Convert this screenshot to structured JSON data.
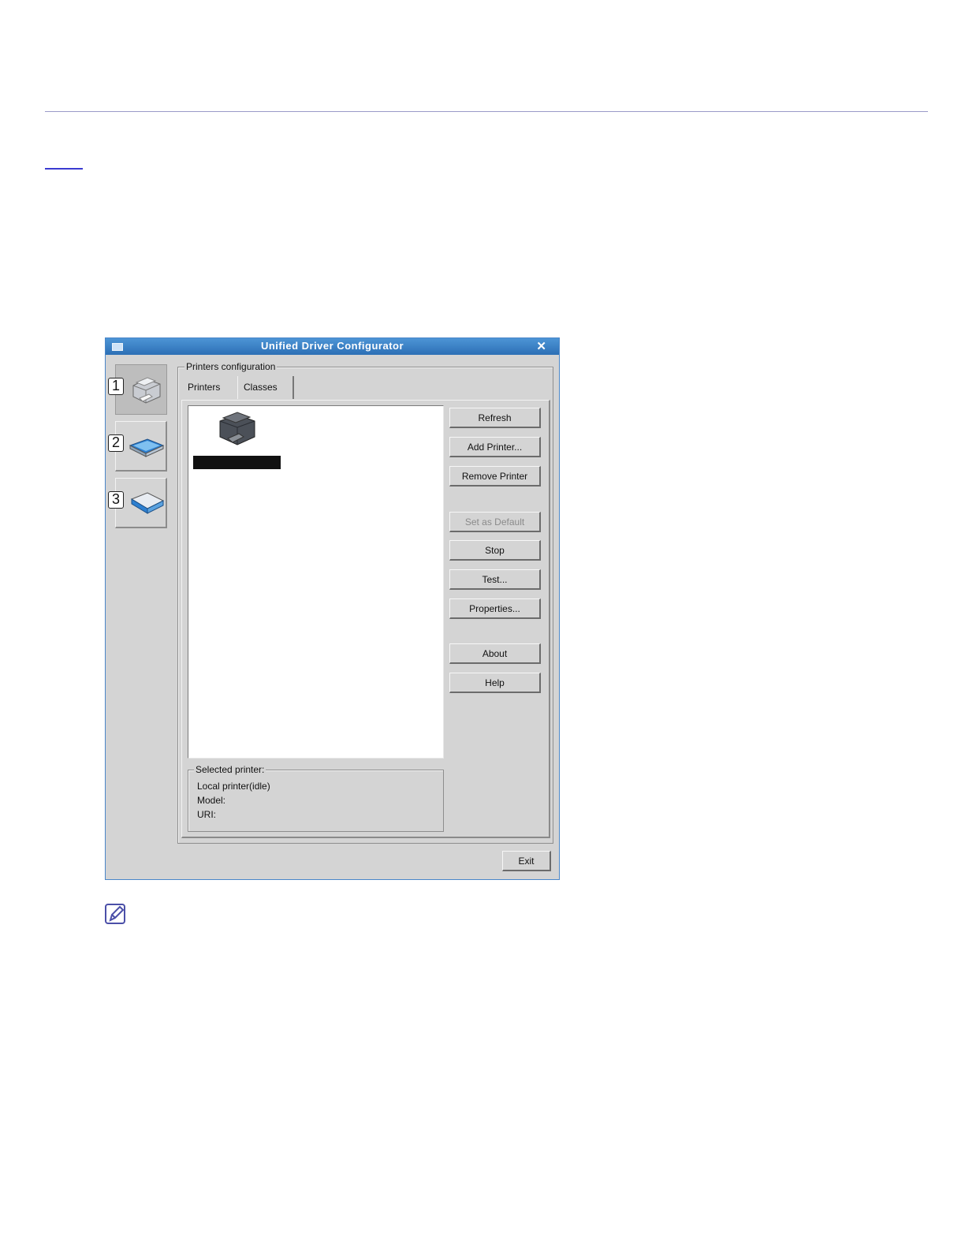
{
  "window": {
    "title": "Unified Driver Configurator",
    "close_glyph": "✕",
    "accent_color": "#2c6fb5"
  },
  "sidebar": {
    "items": [
      {
        "badge": "1",
        "icon": "printer-icon",
        "active": true
      },
      {
        "badge": "2",
        "icon": "scanner-icon",
        "active": false
      },
      {
        "badge": "3",
        "icon": "port-icon",
        "active": false
      }
    ]
  },
  "printers_config": {
    "legend": "Printers configuration",
    "tabs": [
      "Printers",
      "Classes"
    ],
    "active_tab": "Printers"
  },
  "buttons": {
    "refresh": "Refresh",
    "add_printer": "Add Printer...",
    "remove_printer": "Remove Printer",
    "set_default": "Set as Default",
    "stop": "Stop",
    "test": "Test...",
    "properties": "Properties...",
    "about": "About",
    "help": "Help"
  },
  "selected_printer": {
    "legend": "Selected printer:",
    "status": "Local printer(idle)",
    "model_label": "Model:",
    "uri_label": "URI:"
  },
  "footer": {
    "exit": "Exit"
  }
}
